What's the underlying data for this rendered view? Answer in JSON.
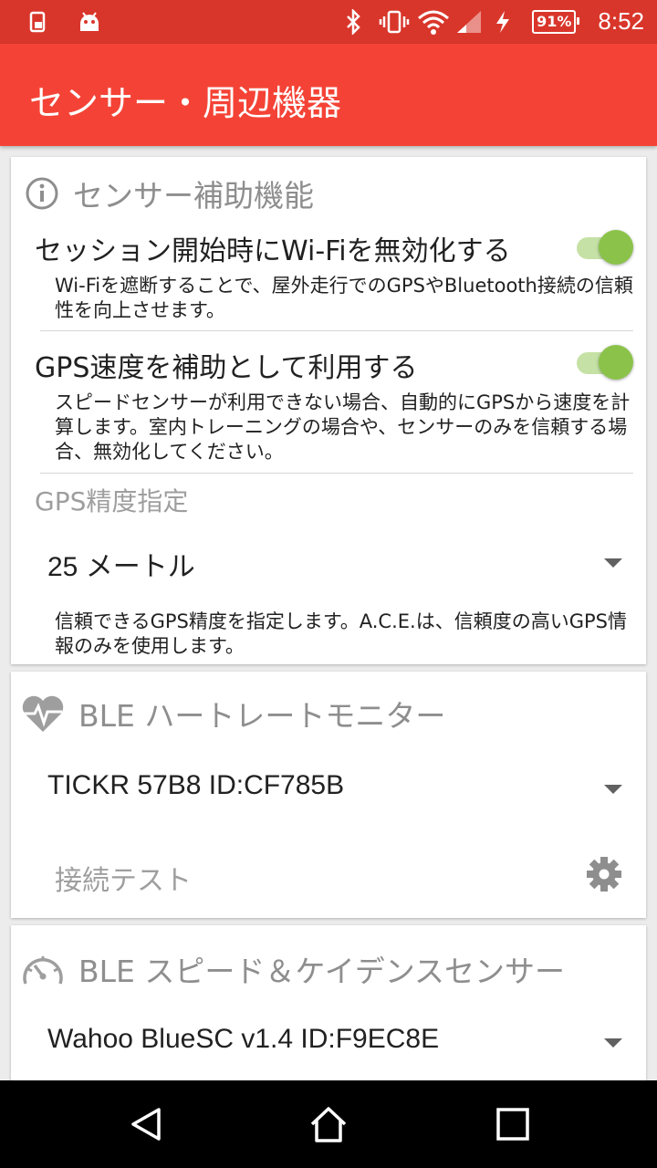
{
  "status_bar": {
    "time": "8:52",
    "battery": "91%",
    "left_icons": [
      "sim-card-icon",
      "android-icon"
    ],
    "right_icons": [
      "bluetooth-icon",
      "vibrate-icon",
      "wifi-icon",
      "signal-icon",
      "charging-icon"
    ]
  },
  "app_bar": {
    "title": "センサー・周辺機器",
    "color": "#f44336"
  },
  "sensor_assist": {
    "heading": "センサー補助機能",
    "wifi_pref": {
      "title": "セッション開始時にWi-Fiを無効化する",
      "summary": "Wi-Fiを遮断することで、屋外走行でのGPSやBluetooth接続の信頼性を向上させます。",
      "enabled": true
    },
    "gps_speed_pref": {
      "title": "GPS速度を補助として利用する",
      "summary": "スピードセンサーが利用できない場合、自動的にGPSから速度を計算します。室内トレーニングの場合や、センサーのみを信頼する場合、無効化してください。",
      "enabled": true
    },
    "gps_accuracy": {
      "label": "GPS精度指定",
      "value": "25 メートル",
      "summary": "信頼できるGPS精度を指定します。A.C.E.は、信頼度の高いGPS情報のみを使用します。"
    }
  },
  "heart_rate": {
    "heading": "BLE ハートレートモニター",
    "device": "TICKR 57B8 ID:CF785B",
    "test_label": "接続テスト"
  },
  "speed_cadence": {
    "heading": "BLE スピード＆ケイデンスセンサー",
    "device": "Wahoo BlueSC v1.4 ID:F9EC8E"
  },
  "colors": {
    "accent_green": "#8bc34a",
    "status_bar": "#d9362b"
  }
}
